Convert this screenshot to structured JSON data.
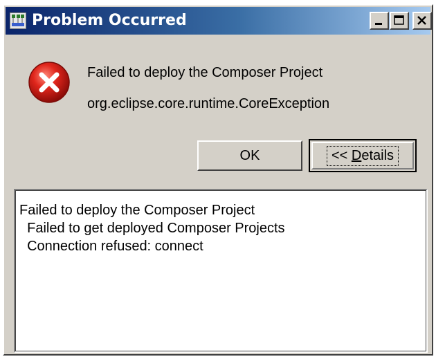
{
  "window": {
    "title": "Problem Occurred",
    "icon": "eclipse-app-icon",
    "controls": {
      "minimize": "minimize-icon",
      "maximize": "maximize-icon",
      "close": "close-icon"
    }
  },
  "message": {
    "icon": "error-icon",
    "primary": "Failed to deploy the Composer Project",
    "secondary": "org.eclipse.core.runtime.CoreException"
  },
  "buttons": {
    "ok": "OK",
    "details_prefix": "<< ",
    "details_mnemonic": "D",
    "details_rest": "etails"
  },
  "details": {
    "lines": [
      "Failed to deploy the Composer Project",
      "  Failed to get deployed Composer Projects",
      "  Connection refused: connect"
    ]
  },
  "colors": {
    "titlebar_start": "#0a246a",
    "titlebar_end": "#a6caf0",
    "dialog_face": "#d4d0c8",
    "error_red": "#d8201a"
  }
}
